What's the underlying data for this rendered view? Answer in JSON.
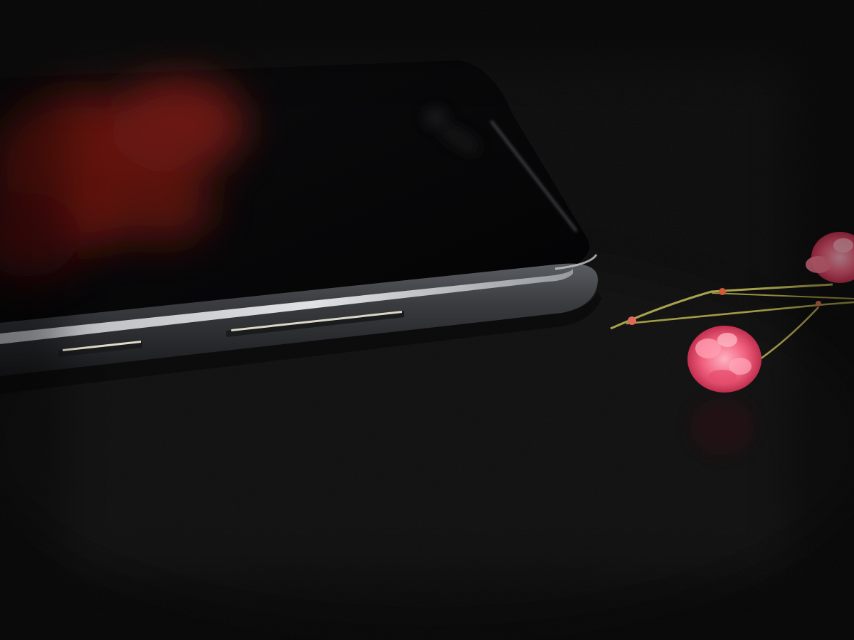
{
  "photo": {
    "subject": "smartphone-side-profile",
    "colors": {
      "background": "#070707",
      "phone_frame": "#3a3c40",
      "frame_highlight": "#e9ecef",
      "screen_glass": "#050507",
      "reflection_red": "#8a1a14",
      "flower_pink": "#f0607e",
      "stem_green": "#a9a24e"
    }
  }
}
